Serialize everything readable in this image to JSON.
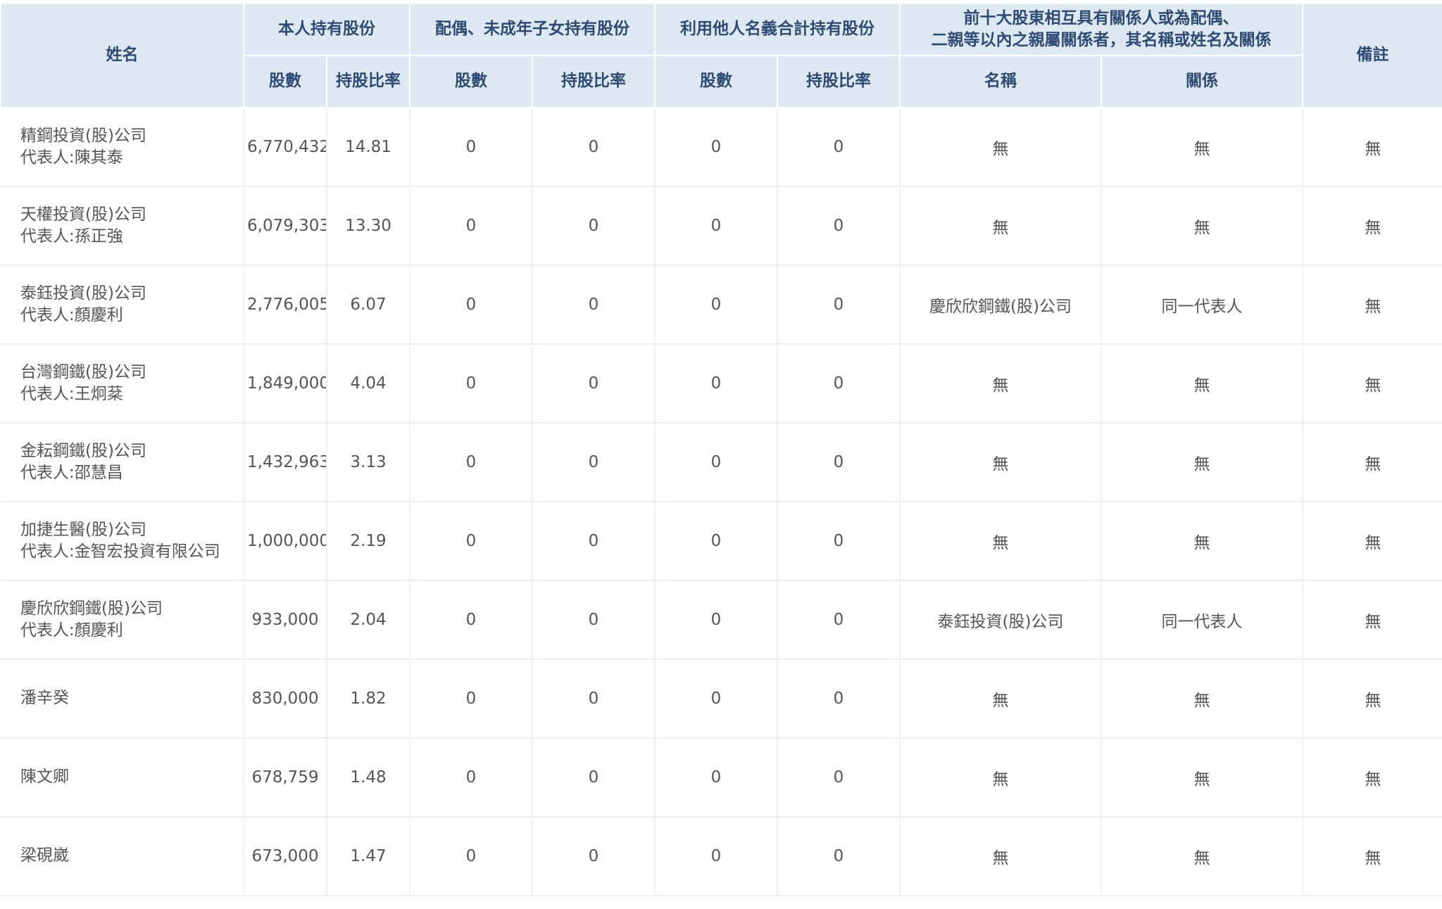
{
  "header": {
    "name": "姓名",
    "own": "本人持有股份",
    "spouse": "配偶、未成年子女持有股份",
    "nominee": "利用他人名義合計持有股份",
    "related_line1": "前十大股東相互具有關係人或為配偶、",
    "related_line2": "二親等以內之親屬關係者，其名稱或姓名及關係",
    "remark": "備註",
    "shares": "股數",
    "ratio": "持股比率",
    "rel_name": "名稱",
    "relation": "關係"
  },
  "rows": [
    {
      "name1": "精鋼投資(股)公司",
      "name2": "代表人:陳其泰",
      "shares": "6,770,432",
      "ratio": "14.81",
      "sp_shares": "0",
      "sp_ratio": "0",
      "nm_shares": "0",
      "nm_ratio": "0",
      "rel_name": "無",
      "relation": "無",
      "remark": "無"
    },
    {
      "name1": "天權投資(股)公司",
      "name2": "代表人:孫正強",
      "shares": "6,079,303",
      "ratio": "13.30",
      "sp_shares": "0",
      "sp_ratio": "0",
      "nm_shares": "0",
      "nm_ratio": "0",
      "rel_name": "無",
      "relation": "無",
      "remark": "無"
    },
    {
      "name1": "泰鈺投資(股)公司",
      "name2": "代表人:顏慶利",
      "shares": "2,776,005",
      "ratio": "6.07",
      "sp_shares": "0",
      "sp_ratio": "0",
      "nm_shares": "0",
      "nm_ratio": "0",
      "rel_name": "慶欣欣鋼鐵(股)公司",
      "relation": "同一代表人",
      "remark": "無"
    },
    {
      "name1": "台灣鋼鐵(股)公司",
      "name2": "代表人:王炯棻",
      "shares": "1,849,000",
      "ratio": "4.04",
      "sp_shares": "0",
      "sp_ratio": "0",
      "nm_shares": "0",
      "nm_ratio": "0",
      "rel_name": "無",
      "relation": "無",
      "remark": "無"
    },
    {
      "name1": "金耘鋼鐵(股)公司",
      "name2": "代表人:邵慧昌",
      "shares": "1,432,963",
      "ratio": "3.13",
      "sp_shares": "0",
      "sp_ratio": "0",
      "nm_shares": "0",
      "nm_ratio": "0",
      "rel_name": "無",
      "relation": "無",
      "remark": "無"
    },
    {
      "name1": "加捷生醫(股)公司",
      "name2": "代表人:金智宏投資有限公司",
      "shares": "1,000,000",
      "ratio": "2.19",
      "sp_shares": "0",
      "sp_ratio": "0",
      "nm_shares": "0",
      "nm_ratio": "0",
      "rel_name": "無",
      "relation": "無",
      "remark": "無"
    },
    {
      "name1": "慶欣欣鋼鐵(股)公司",
      "name2": "代表人:顏慶利",
      "shares": "933,000",
      "ratio": "2.04",
      "sp_shares": "0",
      "sp_ratio": "0",
      "nm_shares": "0",
      "nm_ratio": "0",
      "rel_name": "泰鈺投資(股)公司",
      "relation": "同一代表人",
      "remark": "無"
    },
    {
      "name1": "潘辛癸",
      "name2": "",
      "shares": "830,000",
      "ratio": "1.82",
      "sp_shares": "0",
      "sp_ratio": "0",
      "nm_shares": "0",
      "nm_ratio": "0",
      "rel_name": "無",
      "relation": "無",
      "remark": "無"
    },
    {
      "name1": "陳文卿",
      "name2": "",
      "shares": "678,759",
      "ratio": "1.48",
      "sp_shares": "0",
      "sp_ratio": "0",
      "nm_shares": "0",
      "nm_ratio": "0",
      "rel_name": "無",
      "relation": "無",
      "remark": "無"
    },
    {
      "name1": "梁硯崴",
      "name2": "",
      "shares": "673,000",
      "ratio": "1.47",
      "sp_shares": "0",
      "sp_ratio": "0",
      "nm_shares": "0",
      "nm_ratio": "0",
      "rel_name": "無",
      "relation": "無",
      "remark": "無"
    }
  ]
}
